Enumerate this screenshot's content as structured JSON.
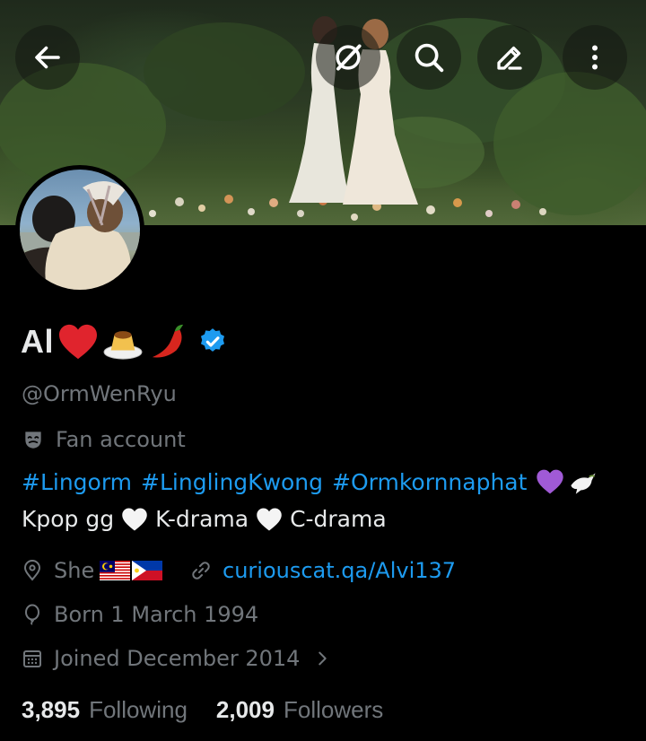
{
  "header": {
    "buttons": [
      {
        "name": "back-button",
        "icon": "arrow-left-icon"
      },
      {
        "name": "grok-button",
        "icon": "slash-circle-icon"
      },
      {
        "name": "search-button",
        "icon": "search-icon"
      },
      {
        "name": "edit-button",
        "icon": "pencil-icon"
      },
      {
        "name": "more-button",
        "icon": "more-vertical-icon"
      }
    ]
  },
  "profile": {
    "display_name": "Al",
    "name_emojis": [
      "❤️",
      "🍮",
      "🌶️"
    ],
    "verified": true,
    "handle": "@OrmWenRyu",
    "category": "Fan account",
    "bio_hashtags": [
      "#Lingorm",
      "#LinglingKwong",
      "#Ormkornnaphat"
    ],
    "bio_hashtag_emojis": [
      "💜",
      "🕊️"
    ],
    "bio_line2": [
      "Kpop gg",
      "🤍",
      "K-drama",
      "🤍",
      "C-drama"
    ],
    "pronouns": "She",
    "pronoun_flags": [
      "🇲🇾",
      "🇵🇭"
    ],
    "website": "curiouscat.qa/Alvi137",
    "birthday": "Born 1 March 1994",
    "joined": "Joined December 2014"
  },
  "stats": {
    "following_count": "3,895",
    "following_label": "Following",
    "followers_count": "2,009",
    "followers_label": "Followers"
  },
  "colors": {
    "background": "#000000",
    "text": "#e7e9ea",
    "muted": "#71767b",
    "accent": "#1d9bf0"
  }
}
